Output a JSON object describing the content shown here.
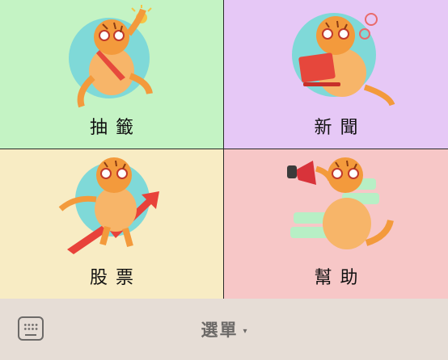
{
  "tiles": [
    {
      "label": "抽籤",
      "bg": "#c4f3c4",
      "icon": "lottery-cat-icon"
    },
    {
      "label": "新聞",
      "bg": "#e6c8f6",
      "icon": "news-cat-icon"
    },
    {
      "label": "股票",
      "bg": "#f8ecc4",
      "icon": "stock-cat-icon"
    },
    {
      "label": "幫助",
      "bg": "#f7c7c7",
      "icon": "help-cat-icon"
    }
  ],
  "bar": {
    "menu_label": "選單",
    "caret": "▾",
    "background": "#e6ddd6",
    "icon": "keyboard-icon"
  }
}
